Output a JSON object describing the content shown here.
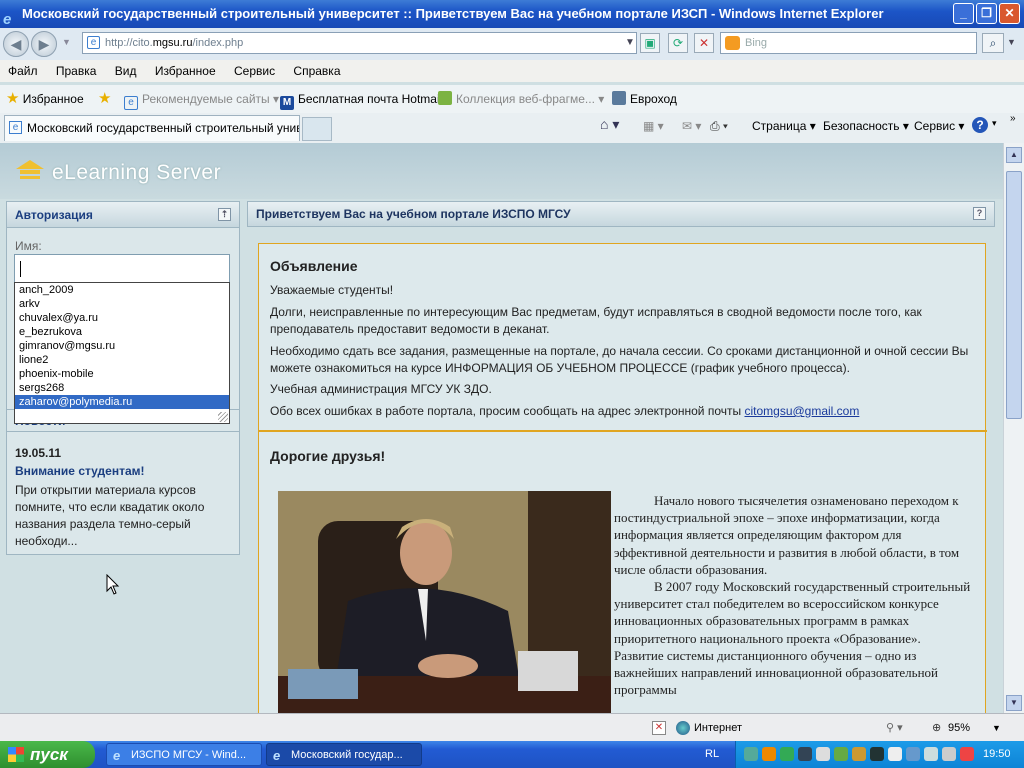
{
  "window": {
    "title": "Московский государственный строительный университет :: Приветствуем Вас на учебном портале ИЗСП - Windows Internet Explorer"
  },
  "address": {
    "prefix": "http://cito.",
    "domain": "mgsu.ru",
    "path": "/index.php"
  },
  "search": {
    "placeholder": "Bing"
  },
  "menu": [
    "Файл",
    "Правка",
    "Вид",
    "Избранное",
    "Сервис",
    "Справка"
  ],
  "favorites": {
    "label": "Избранное",
    "items": [
      "Рекомендуемые сайты",
      "Бесплатная почта Hotmail",
      "Коллекция веб-фрагме...",
      "Евроход"
    ]
  },
  "tab": {
    "label": "Московский государственный строительный унив..."
  },
  "commands": {
    "page": "Страница",
    "safety": "Безопасность",
    "tools": "Сервис"
  },
  "site": {
    "brand": "eLearning Server"
  },
  "auth": {
    "header": "Авторизация",
    "name_label": "Имя:",
    "suggestions": [
      "anch_2009",
      "arkv",
      "chuvalex@ya.ru",
      "e_bezrukova",
      "gimranov@mgsu.ru",
      "lione2",
      "phoenix-mobile",
      "sergs268",
      "zaharov@polymedia.ru"
    ],
    "selected": "zaharov@polymedia.ru"
  },
  "news": {
    "header": "Новости",
    "date": "19.05.11",
    "title": "Внимание студентам!",
    "text": "При открытии материала курсов помните, что если квадатик около названия раздела темно-серый необходи..."
  },
  "main": {
    "header": "Приветствуем Вас на учебном портале ИЗСПО МГСУ",
    "announcement_title": "Объявление",
    "p1": "Уважаемые студенты!",
    "p2": "Долги, неисправленные по интересующим Вас предметам, будут исправляться в сводной ведомости после того, как преподаватель предоставит ведомости в деканат.",
    "p3": "Необходимо сдать все задания, размещенные на портале, до начала сессии. Со сроками дистанционной и очной сессии Вы можете ознакомиться на курсе ИНФОРМАЦИЯ ОБ УЧЕБНОМ ПРОЦЕССЕ (график учебного процесса).",
    "p4": "Учебная администрация МГСУ УК ЗДО.",
    "p5": "Обо всех ошибках в работе портала, просим сообщать на адрес электронной почты ",
    "email": "citomgsu@gmail.com",
    "friends_title": "Дорогие друзья!",
    "body1": "Начало нового тысячелетия ознаменовано переходом к постиндустриальной эпохе – эпохе информатизации, когда информация является определяющим фактором для эффективной деятельности и развития в любой области, в том числе области образования.",
    "body2": "В 2007 году Московский государственный строительный университет  стал победителем во всероссийском конкурсе инновационных образовательных программ в рамках приоритетного национального проекта «Образование». Развитие системы дистанционного обучения – одно из важнейших направлений инновационной образовательной программы"
  },
  "status": {
    "zone": "Интернет",
    "zoom": "95%"
  },
  "taskbar": {
    "start": "пуск",
    "tasks": [
      "ИЗСПО МГСУ - Wind...",
      "Московский государ..."
    ],
    "lang": "RL",
    "clock": "19:50"
  },
  "colors": {
    "accent": "#e0a520",
    "link": "#1a3a9c",
    "header_text": "#1b3e80",
    "selection": "#316ac5"
  }
}
